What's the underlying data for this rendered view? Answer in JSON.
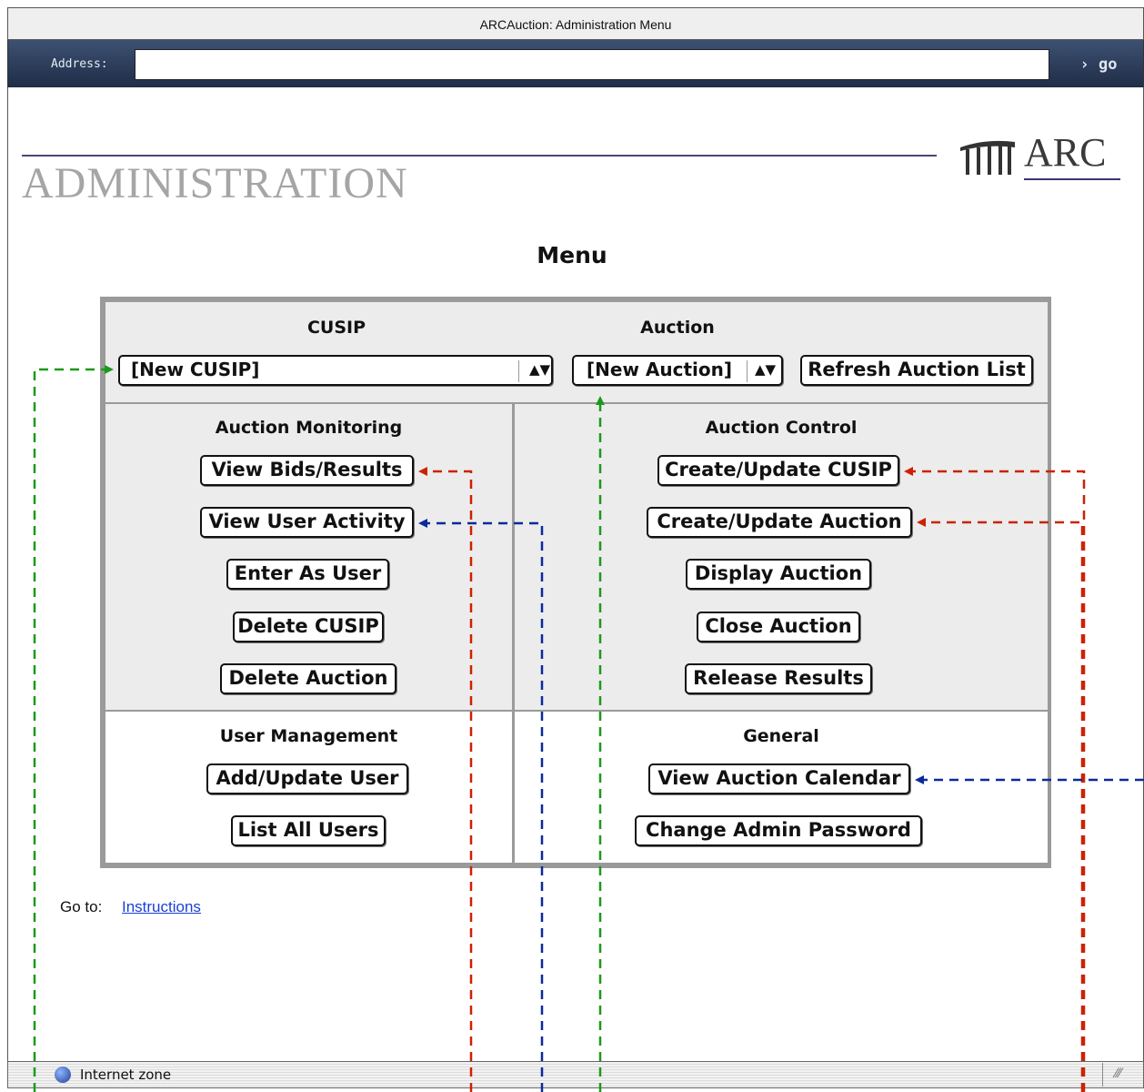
{
  "window": {
    "title": "ARCAuction: Administration Menu"
  },
  "address_bar": {
    "label": "Address:",
    "value": "",
    "go_label": "› go"
  },
  "header": {
    "title": "ADMINISTRATION",
    "logo_text": "ARC"
  },
  "page": {
    "menu_title": "Menu"
  },
  "top_section": {
    "cusip_header": "CUSIP",
    "auction_header": "Auction",
    "cusip_select": "[New CUSIP]",
    "auction_select": "[New Auction]",
    "refresh_button": "Refresh Auction List"
  },
  "auction_monitoring": {
    "header": "Auction Monitoring",
    "buttons": [
      "View Bids/Results",
      "View User Activity",
      "Enter As User",
      "Delete CUSIP",
      "Delete Auction"
    ]
  },
  "auction_control": {
    "header": "Auction Control",
    "buttons": [
      "Create/Update CUSIP",
      "Create/Update Auction",
      "Display Auction",
      "Close Auction",
      "Release Results"
    ]
  },
  "user_management": {
    "header": "User Management",
    "buttons": [
      "Add/Update User",
      "List All Users"
    ]
  },
  "general": {
    "header": "General",
    "buttons": [
      "View Auction Calendar",
      "Change Admin Password"
    ]
  },
  "footer": {
    "goto_label": "Go to:",
    "instructions_link": "Instructions"
  },
  "status_bar": {
    "zone_text": "Internet zone"
  },
  "colors": {
    "annotation_green": "#1a9a1a",
    "annotation_red": "#cc2200",
    "annotation_blue": "#0a2a9a",
    "link": "#1a3fd6"
  }
}
